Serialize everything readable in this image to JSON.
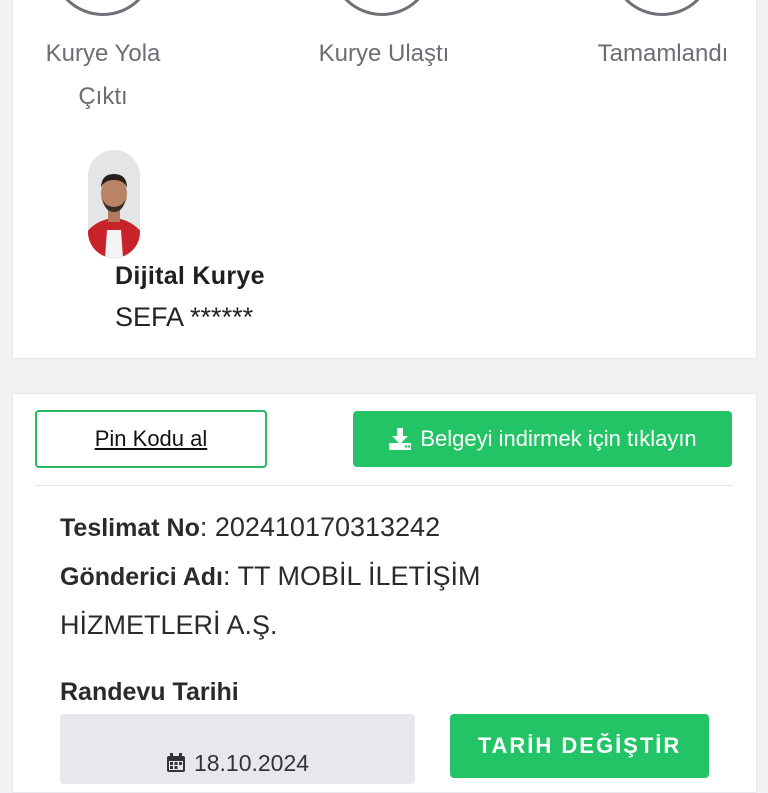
{
  "steps": [
    {
      "label": "Kurye Yola\nÇıktı",
      "icon": "step-circle-icon"
    },
    {
      "label": "Kurye Ulaştı",
      "icon": "step-circle-icon"
    },
    {
      "label": "Tamamlandı",
      "icon": "step-circle-icon"
    }
  ],
  "courier": {
    "title": "Dijital Kurye",
    "name": "SEFA ******"
  },
  "actions": {
    "pin_label": "Pin Kodu al",
    "download_label": "Belgeyi indirmek için tıklayın",
    "download_icon": "download-icon"
  },
  "delivery": {
    "teslimat_label": "Teslimat No",
    "teslimat_value": ": 202410170313242",
    "gonderici_label": "Gönderici Adı",
    "gonderici_value": ": TT MOBİL İLETİŞİM HİZMETLERİ A.Ş."
  },
  "appointment": {
    "label": "Randevu Tarihi",
    "date": "18.10.2024",
    "date_icon": "calendar-icon",
    "change_label": "TARİH DEĞİŞTİR"
  },
  "colors": {
    "accent": "#22c466",
    "step_border": "#6e7176",
    "muted_text": "#6b6e73"
  }
}
